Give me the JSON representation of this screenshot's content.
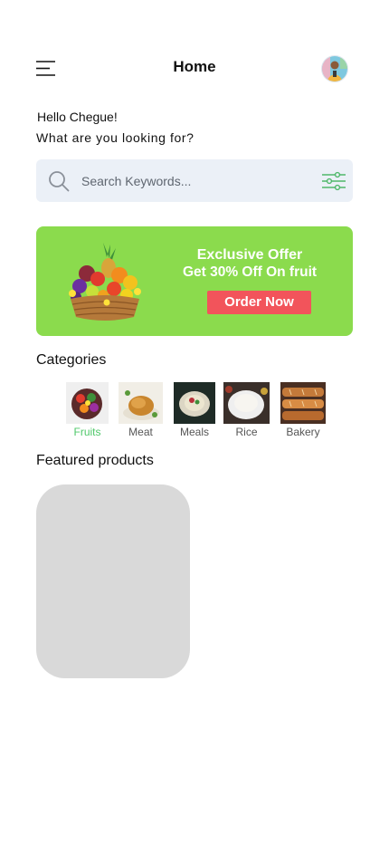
{
  "header": {
    "title": "Home",
    "menu_icon": "hamburger-menu-icon",
    "avatar_icon": "user-avatar"
  },
  "greeting": {
    "hello": "Hello Chegue!",
    "question": "What are you looking for?"
  },
  "search": {
    "placeholder": "Search Keywords...",
    "value": "",
    "icon": "search-icon",
    "filter_icon": "filter-sliders-icon"
  },
  "banner": {
    "title": "Exclusive Offer",
    "subtitle": "Get 30% Off On fruit",
    "button_label": "Order Now",
    "background_color": "#8bdb4d",
    "button_color": "#f2545b"
  },
  "categories": {
    "title": "Categories",
    "items": [
      {
        "label": "Fruits",
        "active": true
      },
      {
        "label": "Meat",
        "active": false
      },
      {
        "label": "Meals",
        "active": false
      },
      {
        "label": "Rice",
        "active": false
      },
      {
        "label": "Bakery",
        "active": false
      }
    ],
    "active_color": "#4fc86a"
  },
  "featured": {
    "title": "Featured products"
  }
}
